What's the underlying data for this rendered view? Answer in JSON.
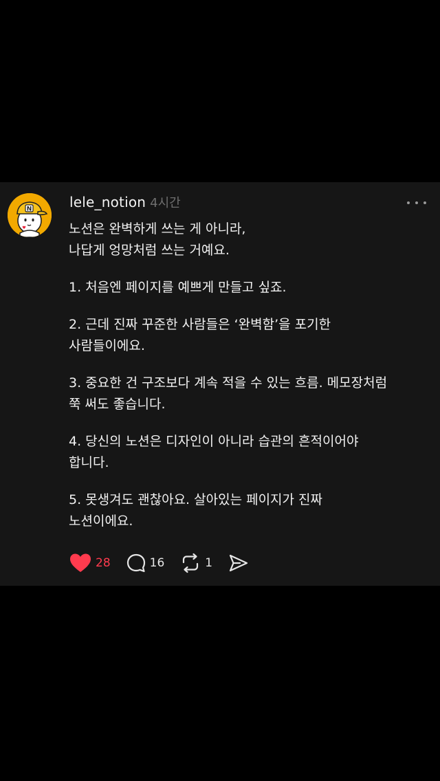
{
  "post": {
    "username": "lele_notion",
    "time": "4시간",
    "avatar_icon": "n-cap-mascot",
    "paragraphs": [
      "노션은 완벽하게 쓰는 게 아니라,\n나답게 엉망처럼 쓰는 거예요.",
      "1. 처음엔 페이지를 예쁘게 만들고 싶죠.",
      "2. 근데 진짜 꾸준한 사람들은 ‘완벽함’을 포기한\n사람들이에요.",
      "3. 중요한 건 구조보다 계속 적을 수 있는 흐름. 메모장처럼\n쭉 써도 좋습니다.",
      "4. 당신의 노션은 디자인이 아니라 습관의 흔적이어야\n합니다.",
      "5. 못생겨도 괜찮아요. 살아있는 페이지가 진짜\n노션이에요."
    ]
  },
  "actions": {
    "like_count": "28",
    "comment_count": "16",
    "repost_count": "1",
    "like_color": "#ff3b4e"
  },
  "colors": {
    "background": "#000000",
    "card": "#161616",
    "text": "#f1f1f1",
    "muted": "#6f6f6f"
  }
}
